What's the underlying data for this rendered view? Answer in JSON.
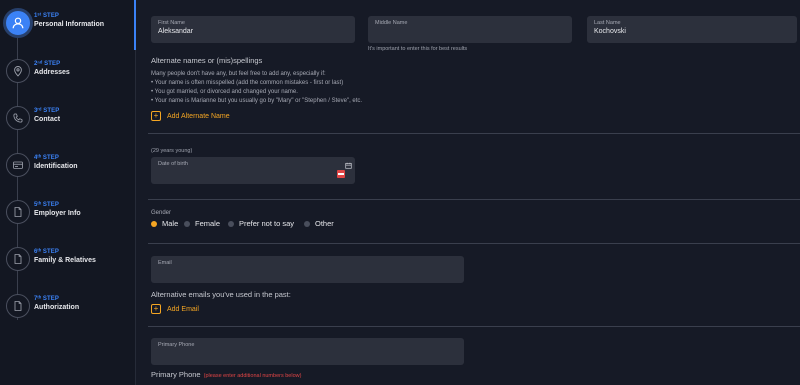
{
  "sidebar": {
    "steps": [
      {
        "num": "1ˢᵗ STEP",
        "name": "Personal Information",
        "icon": "user-icon"
      },
      {
        "num": "2ⁿᵈ STEP",
        "name": "Addresses",
        "icon": "location-pin-icon"
      },
      {
        "num": "3ʳᵈ STEP",
        "name": "Contact",
        "icon": "phone-icon"
      },
      {
        "num": "4ᵗʰ STEP",
        "name": "Identification",
        "icon": "id-card-icon"
      },
      {
        "num": "5ᵗʰ STEP",
        "name": "Employer Info",
        "icon": "document-icon"
      },
      {
        "num": "6ᵗʰ STEP",
        "name": "Family & Relatives",
        "icon": "document-icon"
      },
      {
        "num": "7ᵗʰ STEP",
        "name": "Authorization",
        "icon": "document-icon"
      }
    ],
    "active_index": 0
  },
  "name_fields": {
    "first": {
      "label": "First Name",
      "value": "Aleksandar"
    },
    "middle": {
      "label": "Middle Name",
      "value": "",
      "hint": "It's important to enter this for best results"
    },
    "last": {
      "label": "Last Name",
      "value": "Kochovski"
    }
  },
  "alternate_names": {
    "title": "Alternate names or (mis)spellings",
    "intro": "Many people don't have any, but feel free to add any, especially if:",
    "bullets": [
      "Your name is often misspelled (add the common mistakes - first or last)",
      "You got married, or divorced and changed your name.",
      "Your name is Marianne but you usually go by \"Mary\" or \"Stephen / Steve\", etc."
    ],
    "add_label": "Add Alternate Name"
  },
  "dob": {
    "age_note": "(29 years young)",
    "label": "Date of birth",
    "value": ""
  },
  "gender": {
    "label": "Gender",
    "options": [
      "Male",
      "Female",
      "Prefer not to say",
      "Other"
    ],
    "selected": "Male"
  },
  "email": {
    "label": "Email",
    "value": "",
    "alt_title": "Alternative emails you've used in the past:",
    "add_label": "Add Email"
  },
  "phone": {
    "label": "Primary Phone",
    "value": "",
    "section_title": "Primary Phone",
    "note": "(please enter additional numbers below)"
  },
  "colors": {
    "accent": "#f5a623",
    "primary": "#3b82f6",
    "error": "#e04545"
  }
}
